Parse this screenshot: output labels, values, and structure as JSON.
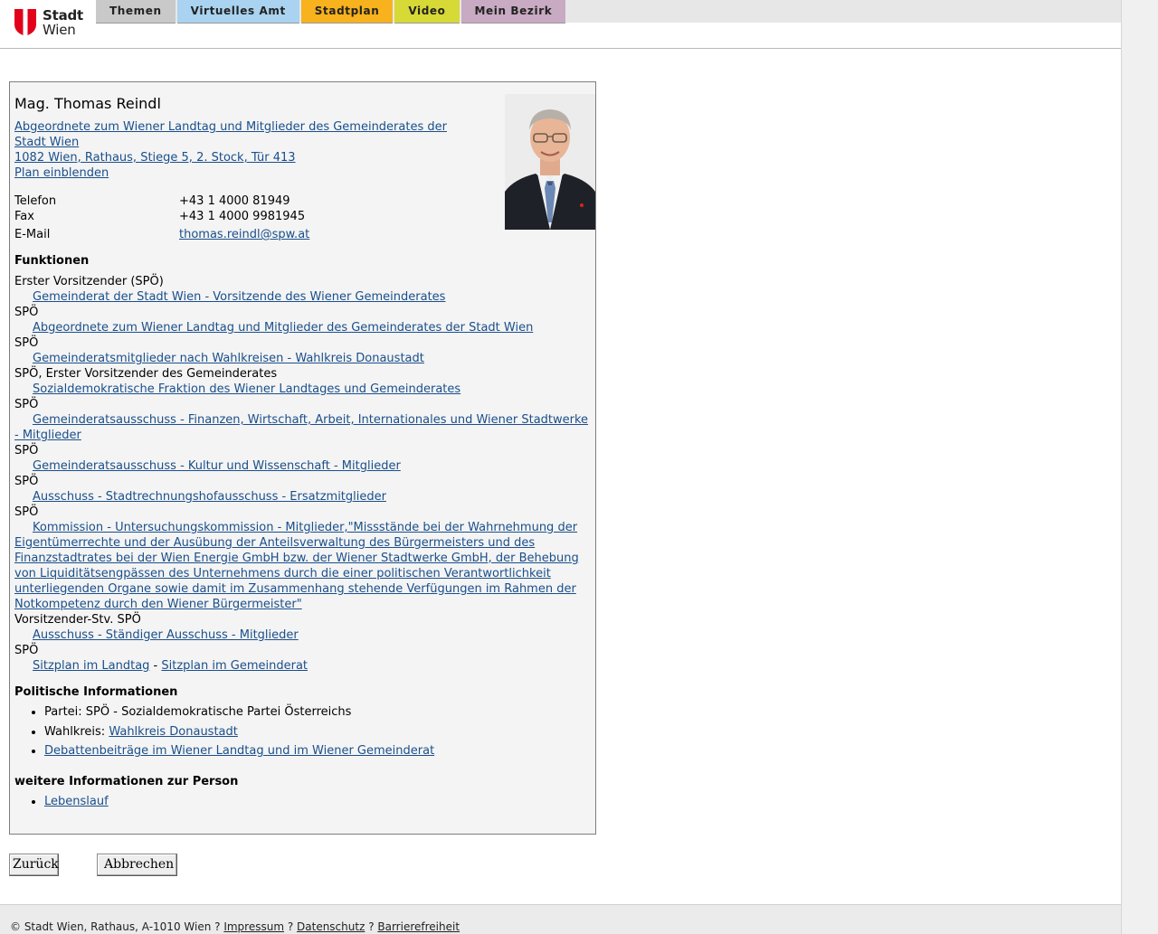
{
  "header": {
    "logo": {
      "line1": "Stadt",
      "line2": "Wien",
      "red": "#e2001a"
    },
    "tabs": [
      {
        "label": "Themen",
        "color": "#c9c9c9"
      },
      {
        "label": "Virtuelles Amt",
        "color": "#a9d3f0"
      },
      {
        "label": "Stadtplan",
        "color": "#f7b21d"
      },
      {
        "label": "Video",
        "color": "#d7d937"
      },
      {
        "label": "Mein Bezirk",
        "color": "#c8aac2"
      }
    ]
  },
  "person": {
    "name": "Mag. Thomas Reindl",
    "address_link1": "Abgeordnete zum Wiener Landtag und Mitglieder des Gemeinderates der Stadt Wien ",
    "address_link2": "1082 Wien, Rathaus, Stiege 5, 2. Stock, Tür 413",
    "plan_link": "Plan einblenden",
    "phone_label": "Telefon",
    "phone": "+43 1 4000 81949",
    "fax_label": "Fax",
    "fax": "+43 1 4000 9981945",
    "email_label": "E-Mail",
    "email": "thomas.reindl@spw.at"
  },
  "funktionen": {
    "title": "Funktionen",
    "items": [
      {
        "role": "Erster Vorsitzender (SPÖ)",
        "org": "Gemeinderat der Stadt Wien - Vorsitzende des Wiener Gemeinderates"
      },
      {
        "role": "SPÖ",
        "org": "Abgeordnete zum Wiener Landtag und Mitglieder des Gemeinderates der Stadt Wien"
      },
      {
        "role": "SPÖ",
        "org": "Gemeinderatsmitglieder nach Wahlkreisen - Wahlkreis Donaustadt"
      },
      {
        "role": "SPÖ, Erster Vorsitzender des Gemeinderates",
        "org": "Sozialdemokratische Fraktion des Wiener Landtages und Gemeinderates"
      },
      {
        "role": "SPÖ",
        "org": "Gemeinderatsausschuss - Finanzen, Wirtschaft, Arbeit, Internationales und Wiener Stadtwerke - Mitglieder"
      },
      {
        "role": "SPÖ",
        "org": "Gemeinderatsausschuss - Kultur und Wissenschaft - Mitglieder"
      },
      {
        "role": "SPÖ",
        "org": "Ausschuss - Stadtrechnungshofausschuss - Ersatzmitglieder"
      },
      {
        "role": "SPÖ",
        "org": "Kommission - Untersuchungskommission - Mitglieder,\"Missstände bei der Wahrnehmung der Eigentümerrechte und der Ausübung der Anteilsverwaltung des Bürgermeisters und des Finanzstadtrates bei der Wien Energie GmbH bzw. der Wiener Stadtwerke GmbH, der Behebung von Liquiditätsengpässen des Unternehmens durch die einer politischen Verantwortlichkeit unterliegenden Organe sowie damit im Zusammenhang stehende Verfügungen im Rahmen der Notkompetenz durch den Wiener Bürgermeister\""
      },
      {
        "role": "Vorsitzender-Stv. SPÖ",
        "org": "Ausschuss - Ständiger Ausschuss - Mitglieder"
      }
    ],
    "last_role": "SPÖ",
    "sitzplan_landtag": "Sitzplan im Landtag",
    "sitzplan_sep": " - ",
    "sitzplan_gemeinderat": "Sitzplan im Gemeinderat"
  },
  "politik": {
    "title": "Politische Informationen",
    "partei_text": "Partei: SPÖ - Sozialdemokratische Partei Österreichs",
    "wahlkreis_label": "Wahlkreis: ",
    "wahlkreis_link": "Wahlkreis Donaustadt",
    "debatten_link": "Debattenbeiträge im Wiener Landtag und im Wiener Gemeinderat"
  },
  "weitere": {
    "title": "weitere Informationen zur Person",
    "lebenslauf": "Lebenslauf"
  },
  "buttons": {
    "back": "Zurück",
    "cancel": "Abbrechen"
  },
  "footer": {
    "copyright": "© Stadt Wien, Rathaus, A-1010 Wien",
    "sep": " ? ",
    "impressum": "Impressum",
    "datenschutz": "Datenschutz",
    "barrierefreiheit": "Barrierefreiheit"
  }
}
